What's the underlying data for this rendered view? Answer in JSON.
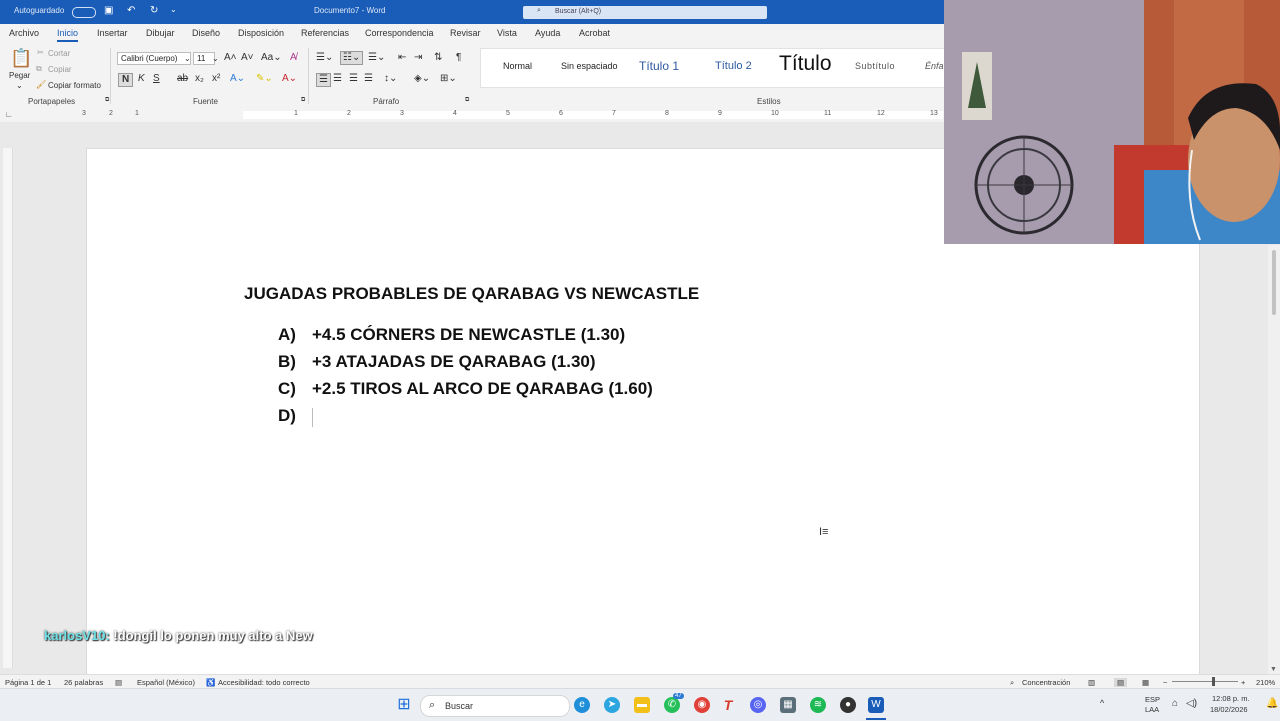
{
  "titlebar": {
    "autosave": "Autoguardado",
    "doc_title": "Documento7 - Word",
    "search_placeholder": "Buscar (Alt+Q)"
  },
  "menu": [
    "Archivo",
    "Inicio",
    "Insertar",
    "Dibujar",
    "Diseño",
    "Disposición",
    "Referencias",
    "Correspondencia",
    "Revisar",
    "Vista",
    "Ayuda",
    "Acrobat"
  ],
  "clipboard": {
    "paste": "Pegar",
    "cut": "Cortar",
    "copy": "Copiar",
    "format_painter": "Copiar formato",
    "group": "Portapapeles"
  },
  "font": {
    "name": "Calibri (Cuerpo)",
    "size": "11",
    "group": "Fuente"
  },
  "paragraph": {
    "group": "Párrafo"
  },
  "styles": {
    "group": "Estilos",
    "items": [
      "Normal",
      "Sin espaciado",
      "Título 1",
      "Título 2",
      "Título",
      "Subtítulo",
      "Énfa"
    ]
  },
  "ruler": {
    "marks": [
      "3",
      "2",
      "1",
      "1",
      "2",
      "3",
      "4",
      "5",
      "6",
      "7",
      "8",
      "9",
      "10",
      "11",
      "12",
      "13"
    ]
  },
  "document": {
    "heading": "JUGADAS PROBABLES DE QARABAG VS NEWCASTLE",
    "items": [
      {
        "letter": "A)",
        "text": "+4.5 CÓRNERS DE NEWCASTLE (1.30)"
      },
      {
        "letter": "B)",
        "text": "+3 ATAJADAS DE QARABAG (1.30)"
      },
      {
        "letter": "C)",
        "text": "+2.5 TIROS AL ARCO DE QARABAG (1.60)"
      },
      {
        "letter": "D)",
        "text": ""
      }
    ]
  },
  "chat": {
    "user": "karlosV10:",
    "message": "!dongil lo ponen muy alto a New"
  },
  "statusbar": {
    "page": "Página 1 de 1",
    "words": "26 palabras",
    "language": "Español (México)",
    "accessibility": "Accesibilidad: todo correcto",
    "focus": "Concentración",
    "zoom": "210%"
  },
  "taskbar": {
    "search": "Buscar",
    "badge": "47",
    "lang": "ESP",
    "lang2": "LAA",
    "time": "12:08 p. m.",
    "date": "18/02/2026"
  },
  "colors": {
    "title_blue": "#1a5db8",
    "chat_user": "#6fe3e8"
  }
}
